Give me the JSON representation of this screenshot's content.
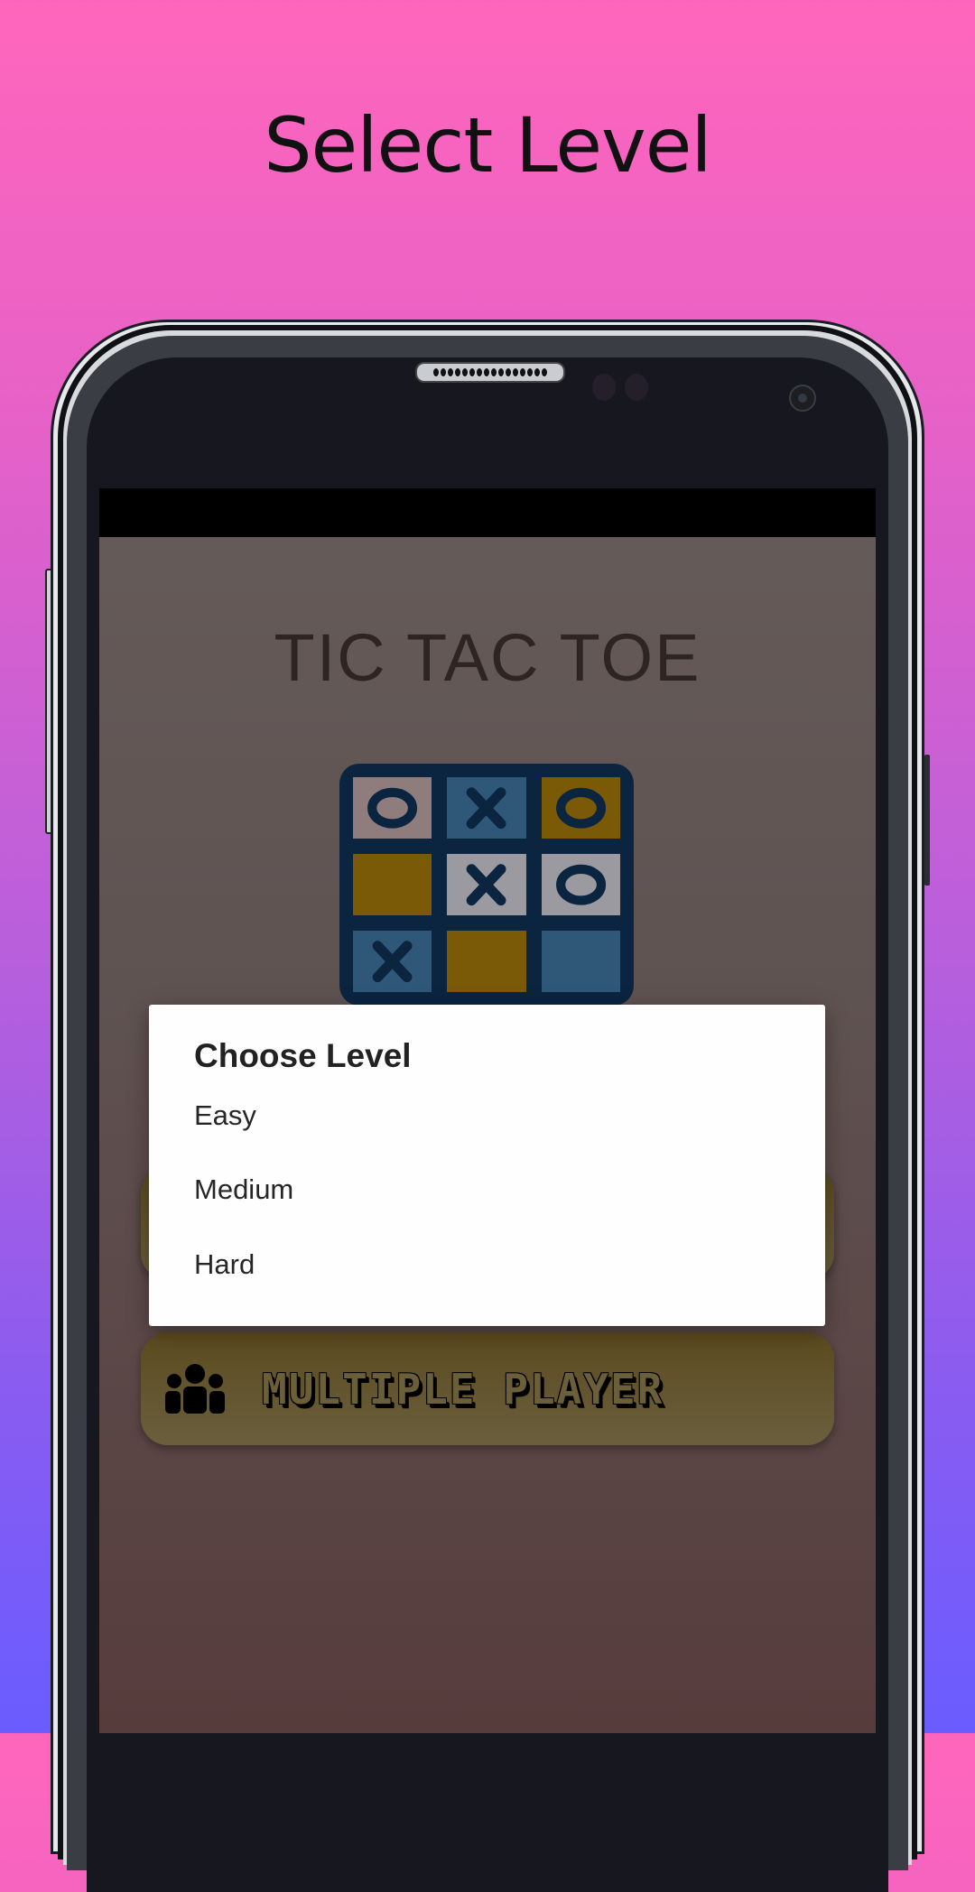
{
  "promo": {
    "title": "Select Level"
  },
  "colors": {
    "background_top": "#ff66bb",
    "background_bottom": "#6a5cff",
    "board_frame": "#0b2440",
    "cell_blue": "#2f5878",
    "cell_gold": "#7a5a06",
    "cell_grey": "#9a9aa0",
    "cell_pink": "#8f7c7c",
    "button_fill": "#5b4a1f",
    "dialog_bg": "#fefefe"
  },
  "app": {
    "title": "TIC TAC TOE",
    "board": {
      "cells": [
        {
          "mark": "O",
          "color": "pink"
        },
        {
          "mark": "X",
          "color": "blue"
        },
        {
          "mark": "O",
          "color": "gold"
        },
        {
          "mark": "",
          "color": "gold"
        },
        {
          "mark": "X",
          "color": "grey"
        },
        {
          "mark": "O",
          "color": "grey"
        },
        {
          "mark": "X",
          "color": "blue"
        },
        {
          "mark": "",
          "color": "gold"
        },
        {
          "mark": "",
          "color": "blue"
        }
      ]
    },
    "buttons": {
      "multi_player": {
        "label": "MULTIPLE PLAYER",
        "icon": "group-icon"
      }
    }
  },
  "dialog": {
    "title": "Choose Level",
    "options": [
      {
        "label": "Easy"
      },
      {
        "label": "Medium"
      },
      {
        "label": "Hard"
      }
    ]
  }
}
